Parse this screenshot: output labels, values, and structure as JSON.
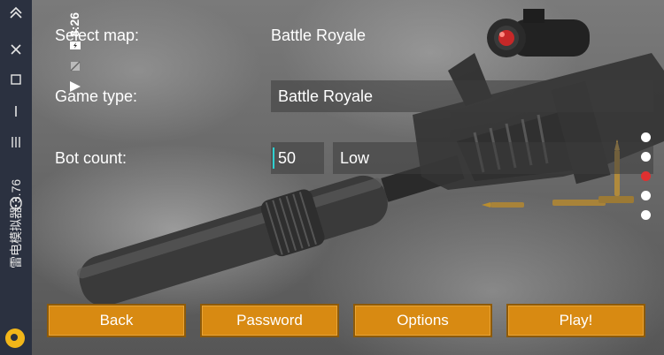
{
  "emulator": {
    "name": "雷电模拟器",
    "version": "3.76",
    "icons": [
      "chevron-up-icon",
      "close-icon",
      "window-icon",
      "minimize-icon",
      "menu-icon",
      "gamepad-icon"
    ]
  },
  "status_bar": {
    "time": "8:26",
    "icons": [
      "battery-charging-icon",
      "no-sim-icon",
      "signal-icon"
    ]
  },
  "form": {
    "select_map_label": "Select map:",
    "select_map_value": "Battle Royale",
    "game_type_label": "Game type:",
    "game_type_value": "Battle Royale",
    "bot_count_label": "Bot count:",
    "bot_count_value": "50",
    "bot_difficulty_value": "Low"
  },
  "page_dots": {
    "count": 5,
    "active_index": 2,
    "active_color": "#e03030",
    "inactive_color": "#ffffff"
  },
  "buttons": {
    "back": "Back",
    "password": "Password",
    "options": "Options",
    "play": "Play!"
  },
  "colors": {
    "button_bg": "#d88a12",
    "button_border": "#8e5a08",
    "sidebar_bg": "#2b3140"
  }
}
